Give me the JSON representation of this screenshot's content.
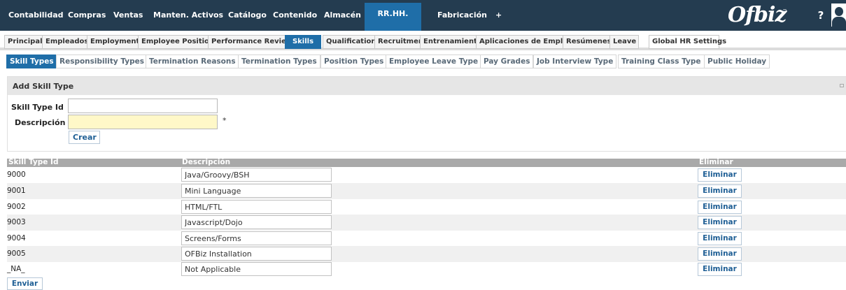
{
  "app_bar": {
    "apps": [
      "Contabilidad",
      "Compras",
      "Ventas",
      "Manten. Activos",
      "Catálogo",
      "Contenido",
      "Almacén",
      "RR.HH.",
      "Fabricación",
      "+"
    ],
    "active_app": "RR.HH.",
    "logo": "Ofbiz",
    "logo_sup": "™",
    "help_glyph": "?"
  },
  "subtabs": {
    "items": [
      "Principal",
      "Empleados",
      "Employments",
      "Employee Position",
      "Performance Review",
      "Skills",
      "Qualifications",
      "Recruitment",
      "Entrenamiento",
      "Aplicaciones de Empleo",
      "Resúmenes",
      "Leave",
      "Global HR Settings"
    ],
    "active": "Skills"
  },
  "settings_nav": {
    "items": [
      "Skill Types",
      "Responsibility Types",
      "Termination Reasons",
      "Termination Types",
      "Position Types",
      "Employee Leave Type",
      "Pay Grades",
      "Job Interview Type",
      "Training Class Type",
      "Public Holiday"
    ],
    "active": "Skill Types"
  },
  "add_form": {
    "title": "Add Skill Type",
    "id_label": "Skill Type Id",
    "id_value": "",
    "desc_label": "Descripción",
    "desc_value": "",
    "required_mark": "*",
    "create_label": "Crear"
  },
  "table": {
    "headers": {
      "id": "Skill Type Id",
      "desc": "Descripción",
      "delete": "Eliminar"
    },
    "delete_label": "Eliminar",
    "rows": [
      {
        "id": "9000",
        "desc": "Java/Groovy/BSH"
      },
      {
        "id": "9001",
        "desc": "Mini Language"
      },
      {
        "id": "9002",
        "desc": "HTML/FTL"
      },
      {
        "id": "9003",
        "desc": "Javascript/Dojo"
      },
      {
        "id": "9004",
        "desc": "Screens/Forms"
      },
      {
        "id": "9005",
        "desc": "OFBiz Installation"
      },
      {
        "id": "_NA_",
        "desc": "Not Applicable"
      }
    ],
    "submit_label": "Enviar"
  },
  "colors": {
    "topbar": "#243c50",
    "accent": "#1f6ea8",
    "table_header": "#a9a9a9",
    "required_field": "#fff8c8"
  }
}
